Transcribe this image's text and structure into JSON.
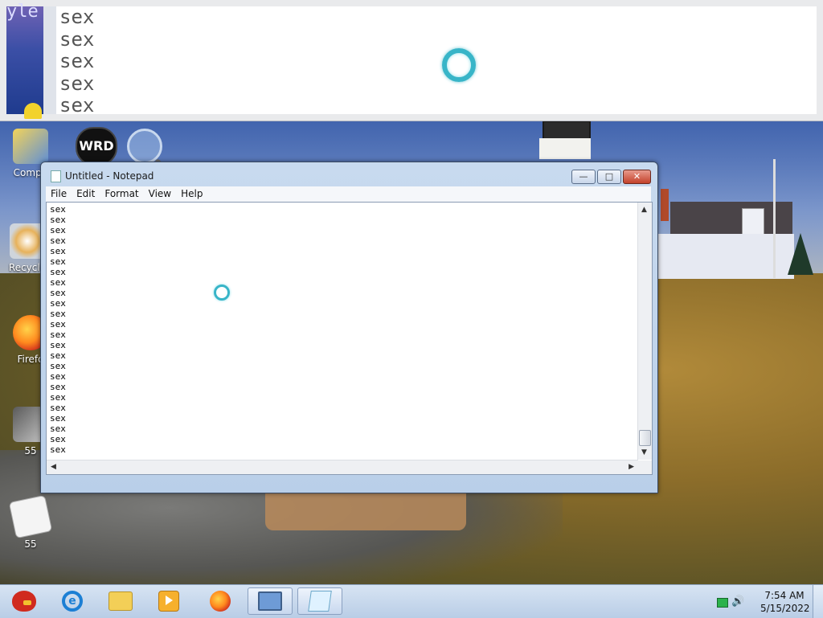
{
  "zoom_view": {
    "left_glyphs": "yle",
    "lines": [
      "sex",
      "sex",
      "sex",
      "sex",
      "sex"
    ]
  },
  "desktop": {
    "icons": [
      {
        "label": "Compu",
        "icon": "computer-icon"
      },
      {
        "label": "Recycle",
        "icon": "recycle-bin-icon"
      },
      {
        "label": "Firefo",
        "icon": "firefox-icon"
      },
      {
        "label": "55",
        "icon": "image-file-icon"
      },
      {
        "label": "55",
        "icon": "text-document-icon"
      }
    ],
    "wrd_badge": "WRD"
  },
  "notepad": {
    "title": "Untitled - Notepad",
    "menu": [
      "File",
      "Edit",
      "Format",
      "View",
      "Help"
    ],
    "lines": [
      "sex",
      "sex",
      "sex",
      "sex",
      "sex",
      "sex",
      "sex",
      "sex",
      "sex",
      "sex",
      "sex",
      "sex",
      "sex",
      "sex",
      "sex",
      "sex",
      "sex",
      "sex",
      "sex",
      "sex",
      "sex",
      "sex",
      "sex",
      "sex"
    ],
    "buttons": {
      "minimize": "—",
      "maximize": "□",
      "close": "✕"
    }
  },
  "taskbar": {
    "apps": [
      "angry-birds-icon",
      "internet-explorer-icon",
      "folder-icon",
      "media-player-icon",
      "firefox-icon",
      "remote-desktop-icon",
      "notepad-icon"
    ],
    "ie_glyph": "e",
    "clock": {
      "time": "7:54 AM",
      "date": "5/15/2022"
    },
    "volume_glyph": "🔊"
  },
  "colors": {
    "accent": "#38b5c8",
    "window_frame": "#b9cfe9",
    "close_button": "#c3412a"
  }
}
